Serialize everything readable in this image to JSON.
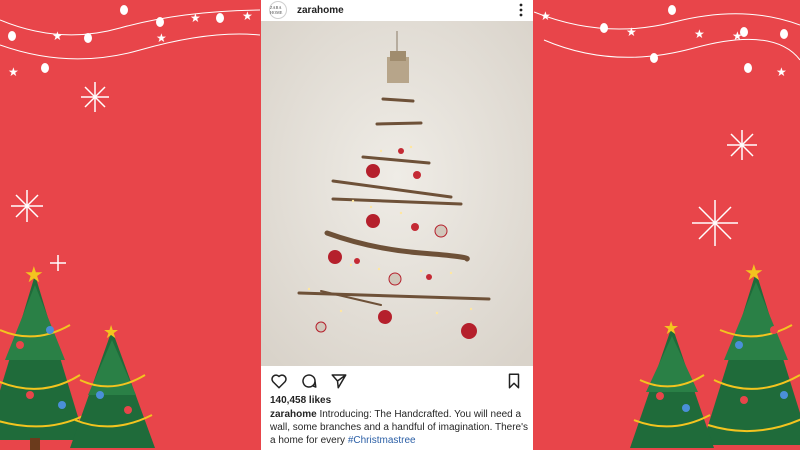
{
  "post": {
    "username": "zarahome",
    "avatar_text": "ZARA HOME",
    "likes": "140,458 likes",
    "caption_user": "zarahome",
    "caption_text": " Introducing: The Handcrafted. You will need a wall, some branches and a handful of imagination. There's a home for every ",
    "caption_hashtag": "#Christmastree"
  },
  "icons": {
    "more": "more-options-icon",
    "like": "heart-icon",
    "comment": "comment-icon",
    "share": "send-icon",
    "save": "bookmark-icon"
  },
  "colors": {
    "background": "#e8454a",
    "tree_green": "#1f6b3a",
    "star_yellow": "#f3c41f",
    "hashtag": "#2b5fa6"
  }
}
